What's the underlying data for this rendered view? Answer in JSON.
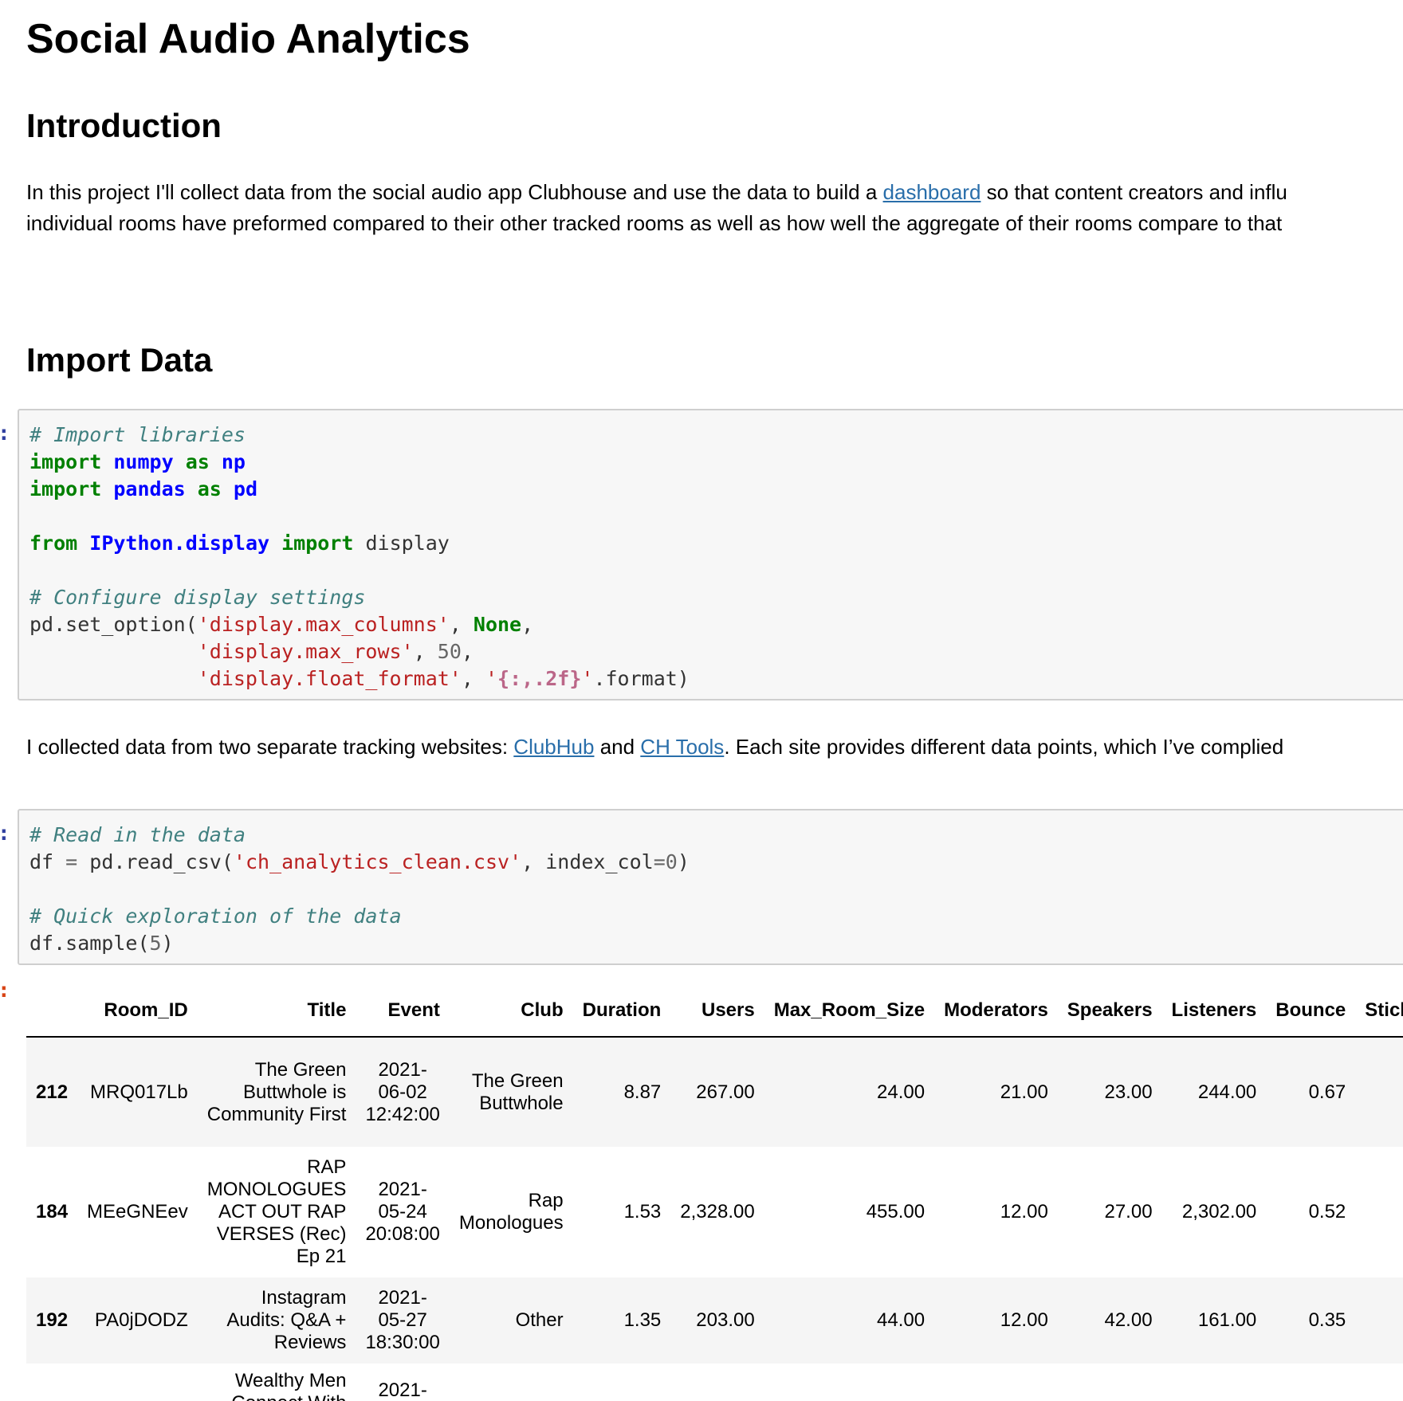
{
  "title": "Social Audio Analytics",
  "intro": {
    "heading": "Introduction",
    "line1_before": "In this project I'll collect data from the social audio app Clubhouse and use the data to build a ",
    "line1_link": "dashboard",
    "line1_after": " so that content creators and influ",
    "line2": "individual rooms have preformed compared to their other tracked rooms as well as how well the aggregate of their rooms compare to that"
  },
  "import_data": {
    "heading": "Import Data",
    "cell1_prompt": ":",
    "sources_before": "I collected data from two separate tracking websites: ",
    "link_clubhub": "ClubHub",
    "sources_and": " and ",
    "link_chtools": "CH Tools",
    "sources_after": ". Each site provides different data points, which I’ve complied",
    "cell2_prompt": ":",
    "output_prompt": ":"
  },
  "code": {
    "cell1": {
      "comment_import": "# Import libraries",
      "kw_import": "import",
      "mod_numpy": "numpy",
      "kw_as": "as",
      "alias_np": "np",
      "mod_pandas": "pandas",
      "alias_pd": "pd",
      "kw_from": "from",
      "mod_ipython": "IPython.display",
      "name_display": "display",
      "comment_config": "# Configure display settings",
      "call_set_option": "pd.set_option(",
      "str_max_columns": "'display.max_columns'",
      "sep": ", ",
      "kw_none": "None",
      "trail_comma": ",",
      "indent": "              ",
      "str_max_rows": "'display.max_rows'",
      "num_50": "50",
      "str_float_format": "'display.float_format'",
      "str_fmt_open": "'",
      "str_fmt_interp": "{:,.2f}",
      "str_fmt_close": "'",
      "call_format": ".format)"
    },
    "cell2": {
      "comment_read": "# Read in the data",
      "var_df": "df ",
      "op_eq": "=",
      "call_read_csv": " pd.read_csv(",
      "str_file": "'ch_analytics_clean.csv'",
      "arg_index_col": ", index_col",
      "num_0": "0",
      "close_paren": ")",
      "comment_explore": "# Quick exploration of the data",
      "call_sample": "df.sample(",
      "num_5": "5"
    }
  },
  "table": {
    "columns": [
      "",
      "Room_ID",
      "Title",
      "Event",
      "Club",
      "Duration",
      "Users",
      "Max_Room_Size",
      "Moderators",
      "Speakers",
      "Listeners",
      "Bounce",
      "Stick"
    ],
    "rows": [
      {
        "index": "212",
        "cells": [
          "MRQ017Lb",
          "The Green Buttwhole is Community First",
          "2021-06-02 12:42:00",
          "The Green Buttwhole",
          "8.87",
          "267.00",
          "24.00",
          "21.00",
          "23.00",
          "244.00",
          "0.67",
          ""
        ]
      },
      {
        "index": "184",
        "cells": [
          "MEeGNEev",
          "RAP MONOLOGUES ACT OUT RAP VERSES (Rec) Ep 21",
          "2021-05-24 20:08:00",
          "Rap Monologues",
          "1.53",
          "2,328.00",
          "455.00",
          "12.00",
          "27.00",
          "2,302.00",
          "0.52",
          ""
        ]
      },
      {
        "index": "192",
        "cells": [
          "PA0jDODZ",
          "Instagram Audits: Q&A + Reviews",
          "2021-05-27 18:30:00",
          "Other",
          "1.35",
          "203.00",
          "44.00",
          "12.00",
          "42.00",
          "161.00",
          "0.35",
          ""
        ]
      },
      {
        "index": "",
        "cells": [
          "",
          "Wealthy Men Connect With",
          "2021-",
          "",
          "",
          "",
          "",
          "",
          "",
          "",
          "",
          ""
        ]
      }
    ]
  }
}
